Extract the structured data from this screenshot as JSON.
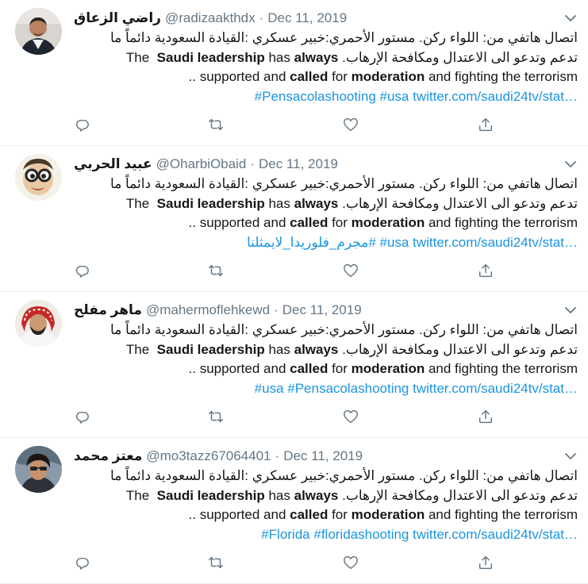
{
  "tweets": [
    {
      "name": "راضي الزعاق",
      "handle": "@radizaakthdx",
      "separator": "·",
      "date": "Dec 11, 2019",
      "line1": "اتصال هاتفي من: اللواء ركن. مستور الأحمري:خبير عسكري :القيادة السعودية دائماً ما",
      "line2_ar": "تدعم وتدعو الى الاعتدال ومكافحة الإرهاب.",
      "line3": ".. supported and called for moderation and fighting the terrorism",
      "tags": [
        "#Pensacolashooting",
        "#usa",
        "twitter.com/saudi24tv/stat…"
      ]
    },
    {
      "name": "عبيد الحربي",
      "handle": "@OharbiObaid",
      "separator": "·",
      "date": "Dec 11, 2019",
      "line1": "اتصال هاتفي من: اللواء ركن. مستور الأحمري:خبير عسكري :القيادة السعودية دائماً ما",
      "line2_ar": "تدعم وتدعو الى الاعتدال ومكافحة الإرهاب.",
      "line3": ".. supported and called for moderation and fighting the terrorism",
      "tags": [
        "#مجرم_فلوريدا_لايمثلنا",
        "#usa",
        "twitter.com/saudi24tv/stat…"
      ]
    },
    {
      "name": "ماهر مفلح",
      "handle": "@mahermoflehkewd",
      "separator": "·",
      "date": "Dec 11, 2019",
      "line1": "اتصال هاتفي من: اللواء ركن. مستور الأحمري:خبير عسكري :القيادة السعودية دائماً ما",
      "line2_ar": "تدعم وتدعو الى الاعتدال ومكافحة الإرهاب.",
      "line3": ".. supported and called for moderation and fighting the terrorism",
      "tags": [
        "#usa",
        "#Pensacolashooting",
        "twitter.com/saudi24tv/stat…"
      ]
    },
    {
      "name": "معتز محمد",
      "handle": "@mo3tazz67064401",
      "separator": "·",
      "date": "Dec 11, 2019",
      "line1": "اتصال هاتفي من: اللواء ركن. مستور الأحمري:خبير عسكري :القيادة السعودية دائماً ما",
      "line2_ar": "تدعم وتدعو الى الاعتدال ومكافحة الإرهاب.",
      "line3": ".. supported and called for moderation and fighting the terrorism",
      "tags": [
        "#Florida",
        "#floridashooting",
        "twitter.com/saudi24tv/stat…"
      ]
    }
  ],
  "english_parts": {
    "the": "The",
    "saudi_leadership": "Saudi leadership",
    "has": "has",
    "always": "always",
    "dots": "..",
    "supported_and": "supported and",
    "called": "called",
    "for": "for",
    "moderation": "moderation",
    "and_fighting": "and  fighting the terrorism"
  },
  "icons": {
    "reply": "reply-icon",
    "retweet": "retweet-icon",
    "like": "like-icon",
    "share": "share-icon",
    "more": "chevron-down-icon"
  },
  "colors": {
    "link": "#1b95e0",
    "meta": "#657786",
    "icon": "#657786",
    "divider": "#e6ecf0"
  }
}
